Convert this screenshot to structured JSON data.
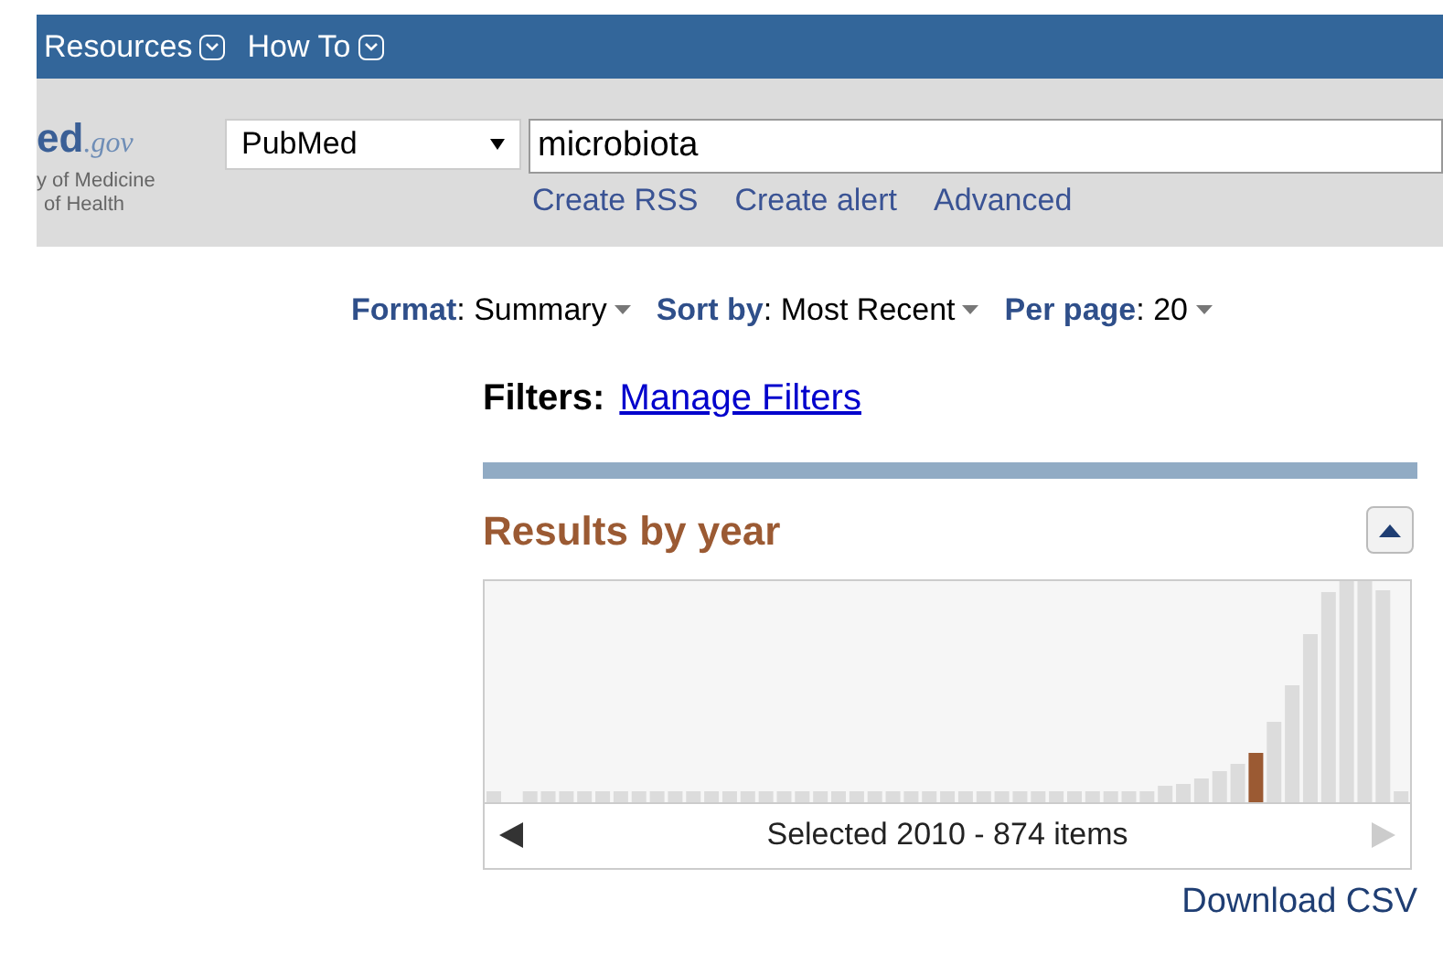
{
  "top_nav": [
    {
      "label": "Resources"
    },
    {
      "label": "How To"
    }
  ],
  "logo": {
    "mark": "ed",
    "domain": ".gov",
    "line1": "y of Medicine",
    "line2": "of Health"
  },
  "search": {
    "database": "PubMed",
    "value": "microbiota",
    "links": [
      "Create RSS",
      "Create alert",
      "Advanced"
    ]
  },
  "display_options": [
    {
      "label": "Format",
      "separator": ":",
      "value": "Summary"
    },
    {
      "label": "Sort by",
      "separator": ":",
      "value": "Most Recent"
    },
    {
      "label": "Per page",
      "separator": ":",
      "value": "20"
    }
  ],
  "filters": {
    "label": "Filters:",
    "link": "Manage Filters"
  },
  "results_by_year": {
    "title": "Results by year",
    "selection": "Selected 2010 - 874 items",
    "download": "Download CSV"
  }
}
